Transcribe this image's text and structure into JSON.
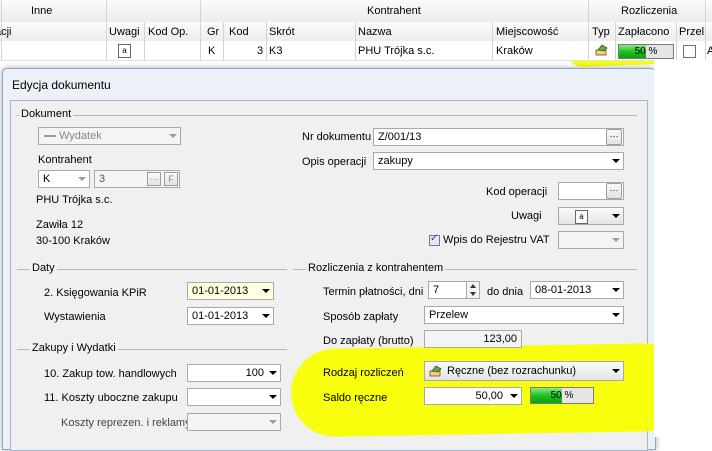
{
  "grid": {
    "group_headers": {
      "other": "Inne",
      "contractor": "Kontrahent",
      "settlements": "Rozliczenia"
    },
    "columns": {
      "cut_left": "acji",
      "notes": "Uwagi",
      "op_code": "Kod Op.",
      "group": "Gr",
      "code": "Kod",
      "short": "Skrót",
      "name": "Nazwa",
      "city": "Miejscowość",
      "type": "Typ",
      "paid": "Zapłacono",
      "transfer": "Przel"
    },
    "row": {
      "notes_icon": "a",
      "group": "K",
      "code": "3",
      "short": "K3",
      "name": "PHU Trójka s.c.",
      "city": "Kraków",
      "paid_pct_label": "50 %",
      "paid_fraction": 0.5,
      "extra": "A"
    }
  },
  "dialog": {
    "title": "Edycja dokumentu",
    "document": {
      "group_title": "Dokument",
      "doc_type": "Wydatek",
      "contractor_label": "Kontrahent",
      "contractor_group": "K",
      "contractor_code": "3",
      "contractor_f": "F",
      "contractor_name": "PHU Trójka s.c.",
      "address_line1": "Zawiła 12",
      "address_line2": "30-100 Kraków",
      "nr_label": "Nr dokumentu",
      "nr_value": "Z/001/13",
      "desc_label": "Opis operacji",
      "desc_value": "zakupy",
      "opcode_label": "Kod operacji",
      "opcode_value": "",
      "notes_label": "Uwagi",
      "notes_icon": "a",
      "vat_label": "Wpis do Rejestru VAT"
    },
    "dates": {
      "group_title": "Daty",
      "kpir_label": "2. Księgowania KPiR",
      "kpir_value": "01-01-2013",
      "issue_label": "Wystawienia",
      "issue_value": "01-01-2013"
    },
    "purchases": {
      "group_title": "Zakupy i Wydatki",
      "goods_label": "10. Zakup tow. handlowych",
      "goods_value": "100",
      "side_label": "11. Koszty uboczne zakupu",
      "side_value": "",
      "repr_label": "Koszty reprezen. i reklamy",
      "repr_value": ""
    },
    "settlements": {
      "group_title": "Rozliczenia z kontrahentem",
      "term_label": "Termin płatności, dni",
      "term_value": "7",
      "until_label": "do dnia",
      "until_value": "08-01-2013",
      "method_label": "Sposób zapłaty",
      "method_value": "Przelew",
      "topay_label": "Do zapłaty (brutto)",
      "topay_value": "123,00",
      "kind_label": "Rodzaj rozliczeń",
      "kind_value": "Ręczne (bez rozrachunku)",
      "balance_label": "Saldo ręczne",
      "balance_value": "50,00",
      "balance_pct_label": "50 %",
      "balance_fraction": 0.5
    }
  },
  "colors": {
    "highlight": "#f7ff00",
    "progress": "#1fc21f",
    "dialog_border": "#8ea6c6"
  }
}
